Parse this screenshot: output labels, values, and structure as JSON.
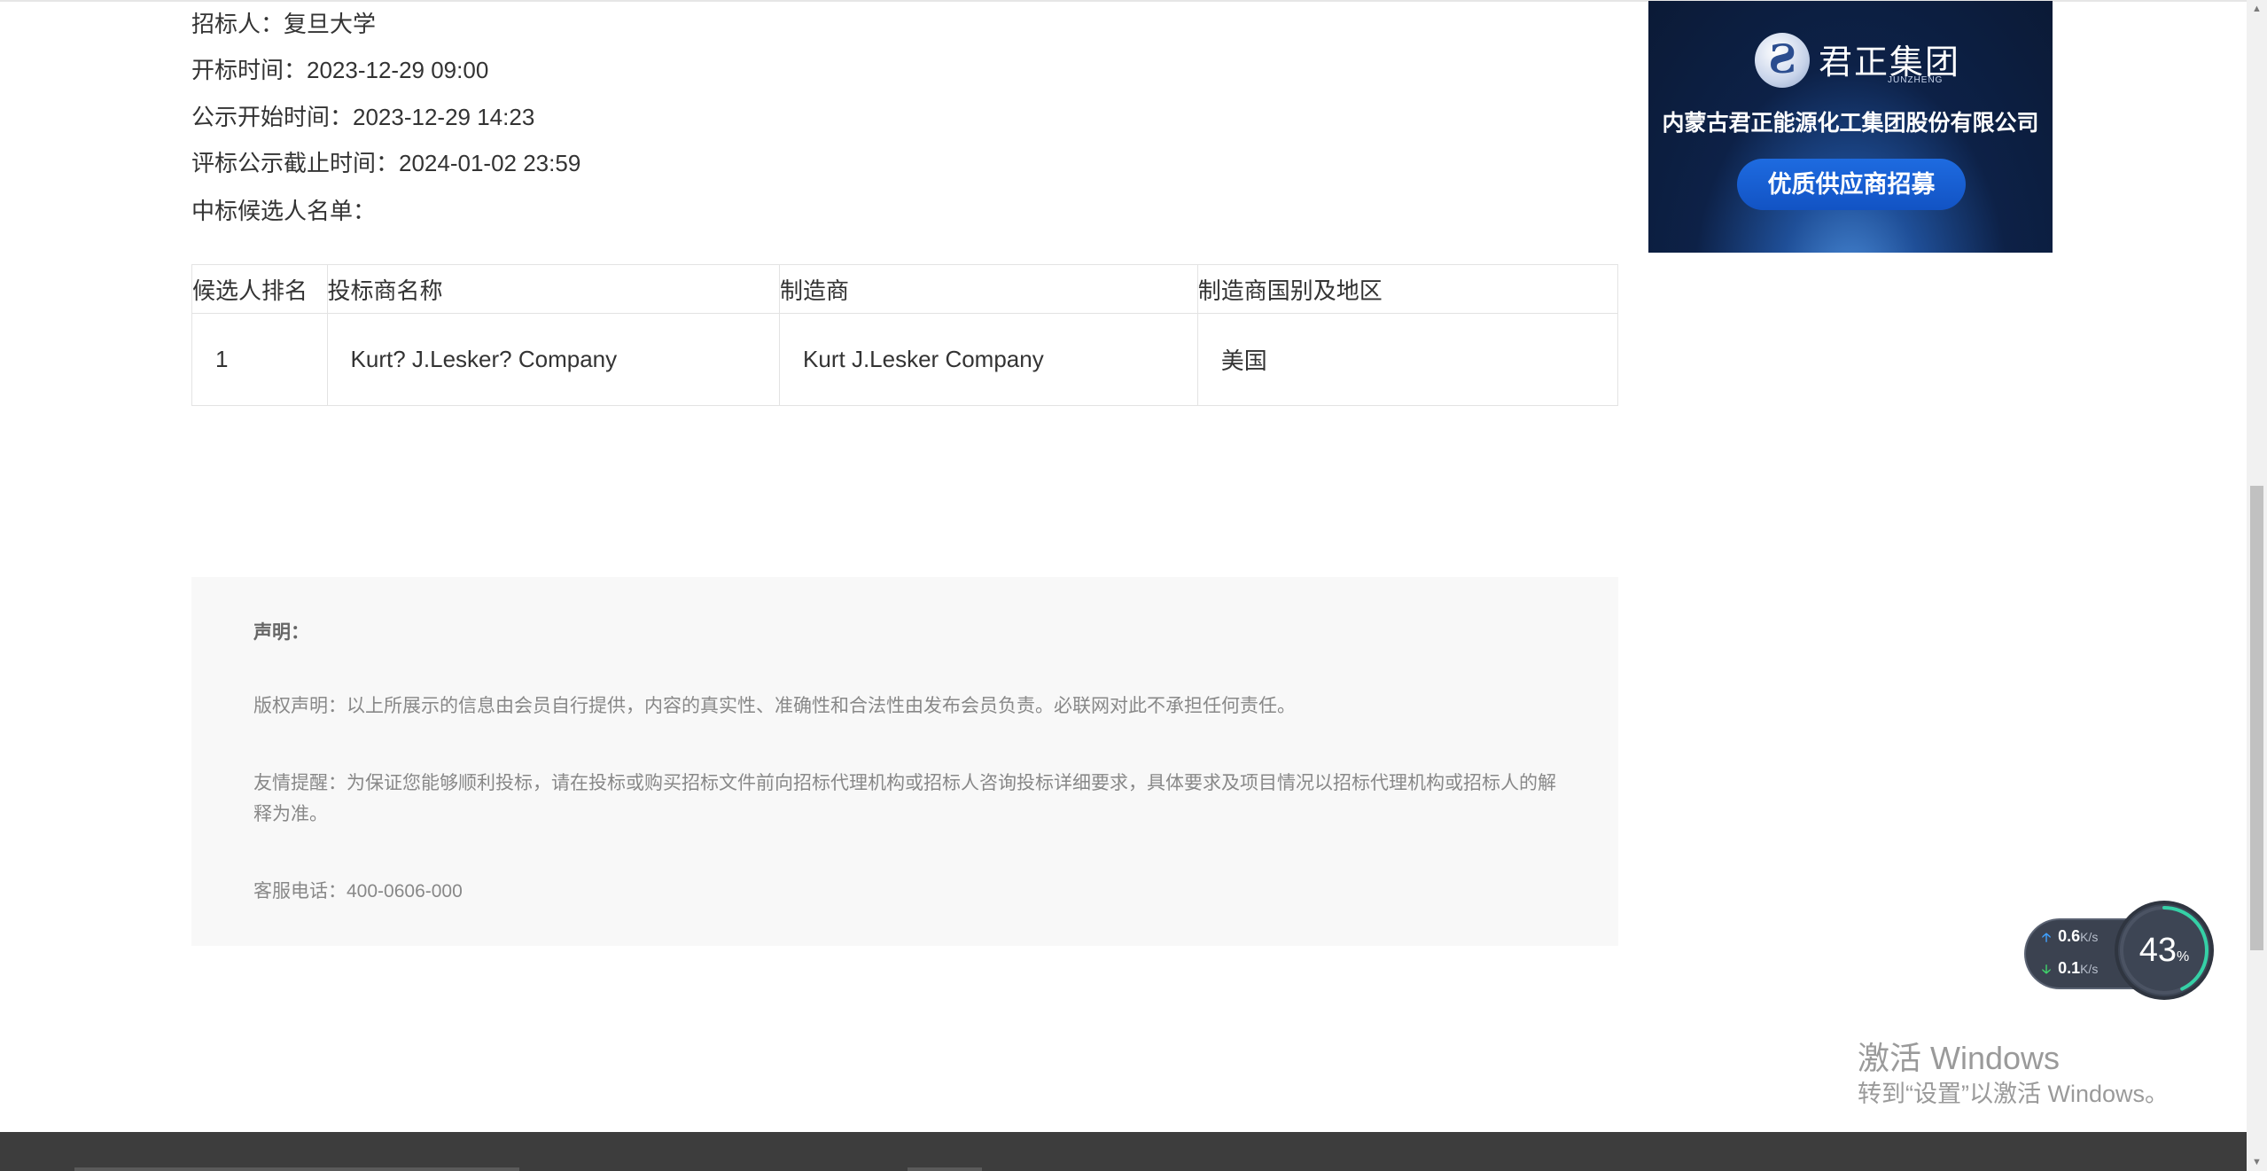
{
  "info": {
    "tenderer": "招标人：复旦大学",
    "bid_opening_time": "开标时间：2023-12-29 09:00",
    "publicity_start_time": "公示开始时间：2023-12-29 14:23",
    "publicity_end_time": "评标公示截止时间：2024-01-02 23:59",
    "candidate_list_label": "中标候选人名单："
  },
  "table": {
    "headers": [
      "候选人排名",
      "投标商名称",
      "制造商",
      "制造商国别及地区"
    ],
    "rows": [
      {
        "rank": "1",
        "bidder": "Kurt?  J.Lesker?  Company",
        "manufacturer": "Kurt J.Lesker Company",
        "country": "美国"
      }
    ]
  },
  "statement": {
    "title": "声明：",
    "copyright": "版权声明：以上所展示的信息由会员自行提供，内容的真实性、准确性和合法性由发布会员负责。必联网对此不承担任何责任。",
    "reminder": "友情提醒：为保证您能够顺利投标，请在投标或购买招标文件前向招标代理机构或招标人咨询投标详细要求，具体要求及项目情况以招标代理机构或招标人的解释为准。",
    "hotline": "客服电话：400-0606-000"
  },
  "ad": {
    "logo_glyph": "Ƨ",
    "brand": "君正集团",
    "brand_en": "JUNZHENG",
    "company": "内蒙古君正能源化工集团股份有限公司",
    "cta": "优质供应商招募"
  },
  "net_widget": {
    "upload_value": "0.6",
    "download_value": "0.1",
    "unit": "K/s",
    "percent": "43",
    "percent_sign": "%",
    "percent_fraction": 0.43
  },
  "watermark": {
    "line1": "激活 Windows",
    "line2": "转到“设置”以激活 Windows。"
  },
  "colors": {
    "accent_blue": "#1e6be0",
    "text": "#333333",
    "muted": "#888888",
    "statement_bg": "#f8f8f8"
  }
}
